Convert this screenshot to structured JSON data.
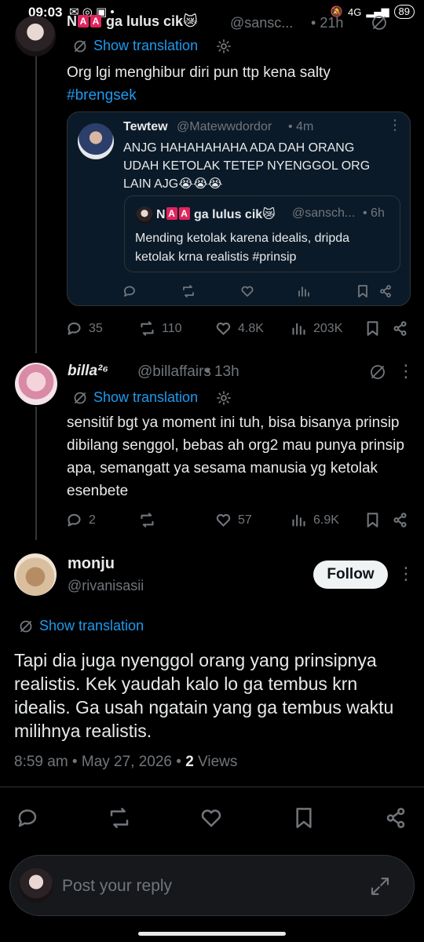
{
  "status_bar": {
    "time": "09:03",
    "network": "4G",
    "battery": "89"
  },
  "post1": {
    "display_name": "ga lulus cik😿",
    "name_prefix": "N",
    "flag_letter": "A",
    "handle": "@sansc...",
    "time": "21h",
    "show_translation": "Show translation",
    "text": "Org lgi menghibur diri pun ttp kena salty",
    "hashtag": "#brengsek",
    "quote": {
      "display_name": "Tewtew",
      "handle": "@Matewwdordor",
      "time": "4m",
      "text": "ANJG HAHAHAHAHA ADA DAH ORANG UDAH KETOLAK TETEP NYENGGOL ORG LAIN AJG😭😭😭",
      "inner": {
        "display_name": "ga lulus cik😿",
        "name_prefix": "N",
        "handle": "@sansch...",
        "time": "6h",
        "text": "Mending ketolak karena idealis, dripda ketolak krna realistis #prinsip"
      }
    },
    "stats": {
      "replies": "35",
      "reposts": "110",
      "likes": "4.8K",
      "views": "203K"
    }
  },
  "post2": {
    "display_name": "billa²⁶",
    "handle": "@billaffairs",
    "time": "13h",
    "show_translation": "Show translation",
    "text": "sensitif bgt ya moment ini tuh, bisa bisanya prinsip dibilang senggol, bebas ah org2 mau punya prinsip apa, semangatt ya sesama manusia yg ketolak esenbete",
    "stats": {
      "replies": "2",
      "reposts": "",
      "likes": "57",
      "views": "6.9K"
    }
  },
  "main_post": {
    "display_name": "monju",
    "handle": "@rivanisasii",
    "follow_label": "Follow",
    "show_translation": "Show translation",
    "text": "Tapi dia juga nyenggol orang yang prinsipnya realistis. Kek yaudah kalo lo ga tembus krn idealis. Ga usah ngatain yang ga tembus waktu milihnya realistis.",
    "timestamp": "8:59 am • May 27, 2026 • ",
    "views_count": "2",
    "views_label": " Views"
  },
  "reply_bar": {
    "placeholder": "Post your reply"
  },
  "colors": {
    "accent": "#1d9bf0",
    "background": "#000000",
    "text": "#e7e9ea",
    "muted": "#71767b"
  }
}
